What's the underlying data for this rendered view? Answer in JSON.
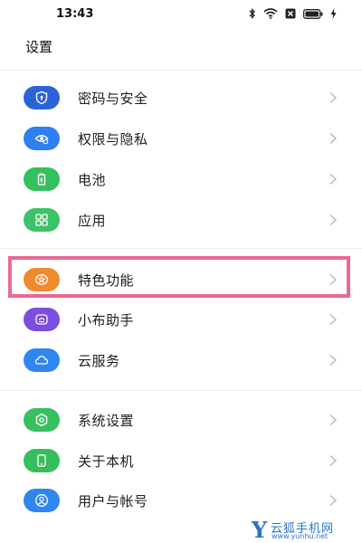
{
  "status_bar": {
    "time": "13:43"
  },
  "header": {
    "title": "设置"
  },
  "settings": {
    "items": [
      {
        "label": "密码与安全",
        "icon": "lock-shield-icon",
        "color": "#2b63d9"
      },
      {
        "label": "权限与隐私",
        "icon": "privacy-eye-icon",
        "color": "#2f7ff0"
      },
      {
        "label": "电池",
        "icon": "battery-icon",
        "color": "#34c15d"
      },
      {
        "label": "应用",
        "icon": "apps-grid-icon",
        "color": "#3cc267"
      },
      {
        "label": "特色功能",
        "icon": "star-feature-icon",
        "color": "#f08a2e"
      },
      {
        "label": "小布助手",
        "icon": "assistant-icon",
        "color": "#7a4fe0"
      },
      {
        "label": "云服务",
        "icon": "cloud-icon",
        "color": "#2f86f0"
      },
      {
        "label": "系统设置",
        "icon": "system-settings-icon",
        "color": "#38c060"
      },
      {
        "label": "关于本机",
        "icon": "phone-info-icon",
        "color": "#36be5c"
      },
      {
        "label": "用户与帐号",
        "icon": "user-account-icon",
        "color": "#2f86f0"
      }
    ]
  },
  "annotation": {
    "highlight_color": "#e66a93"
  },
  "watermark": {
    "logo": "Y",
    "name": "云狐手机网",
    "url": "www.yunhu.net"
  }
}
